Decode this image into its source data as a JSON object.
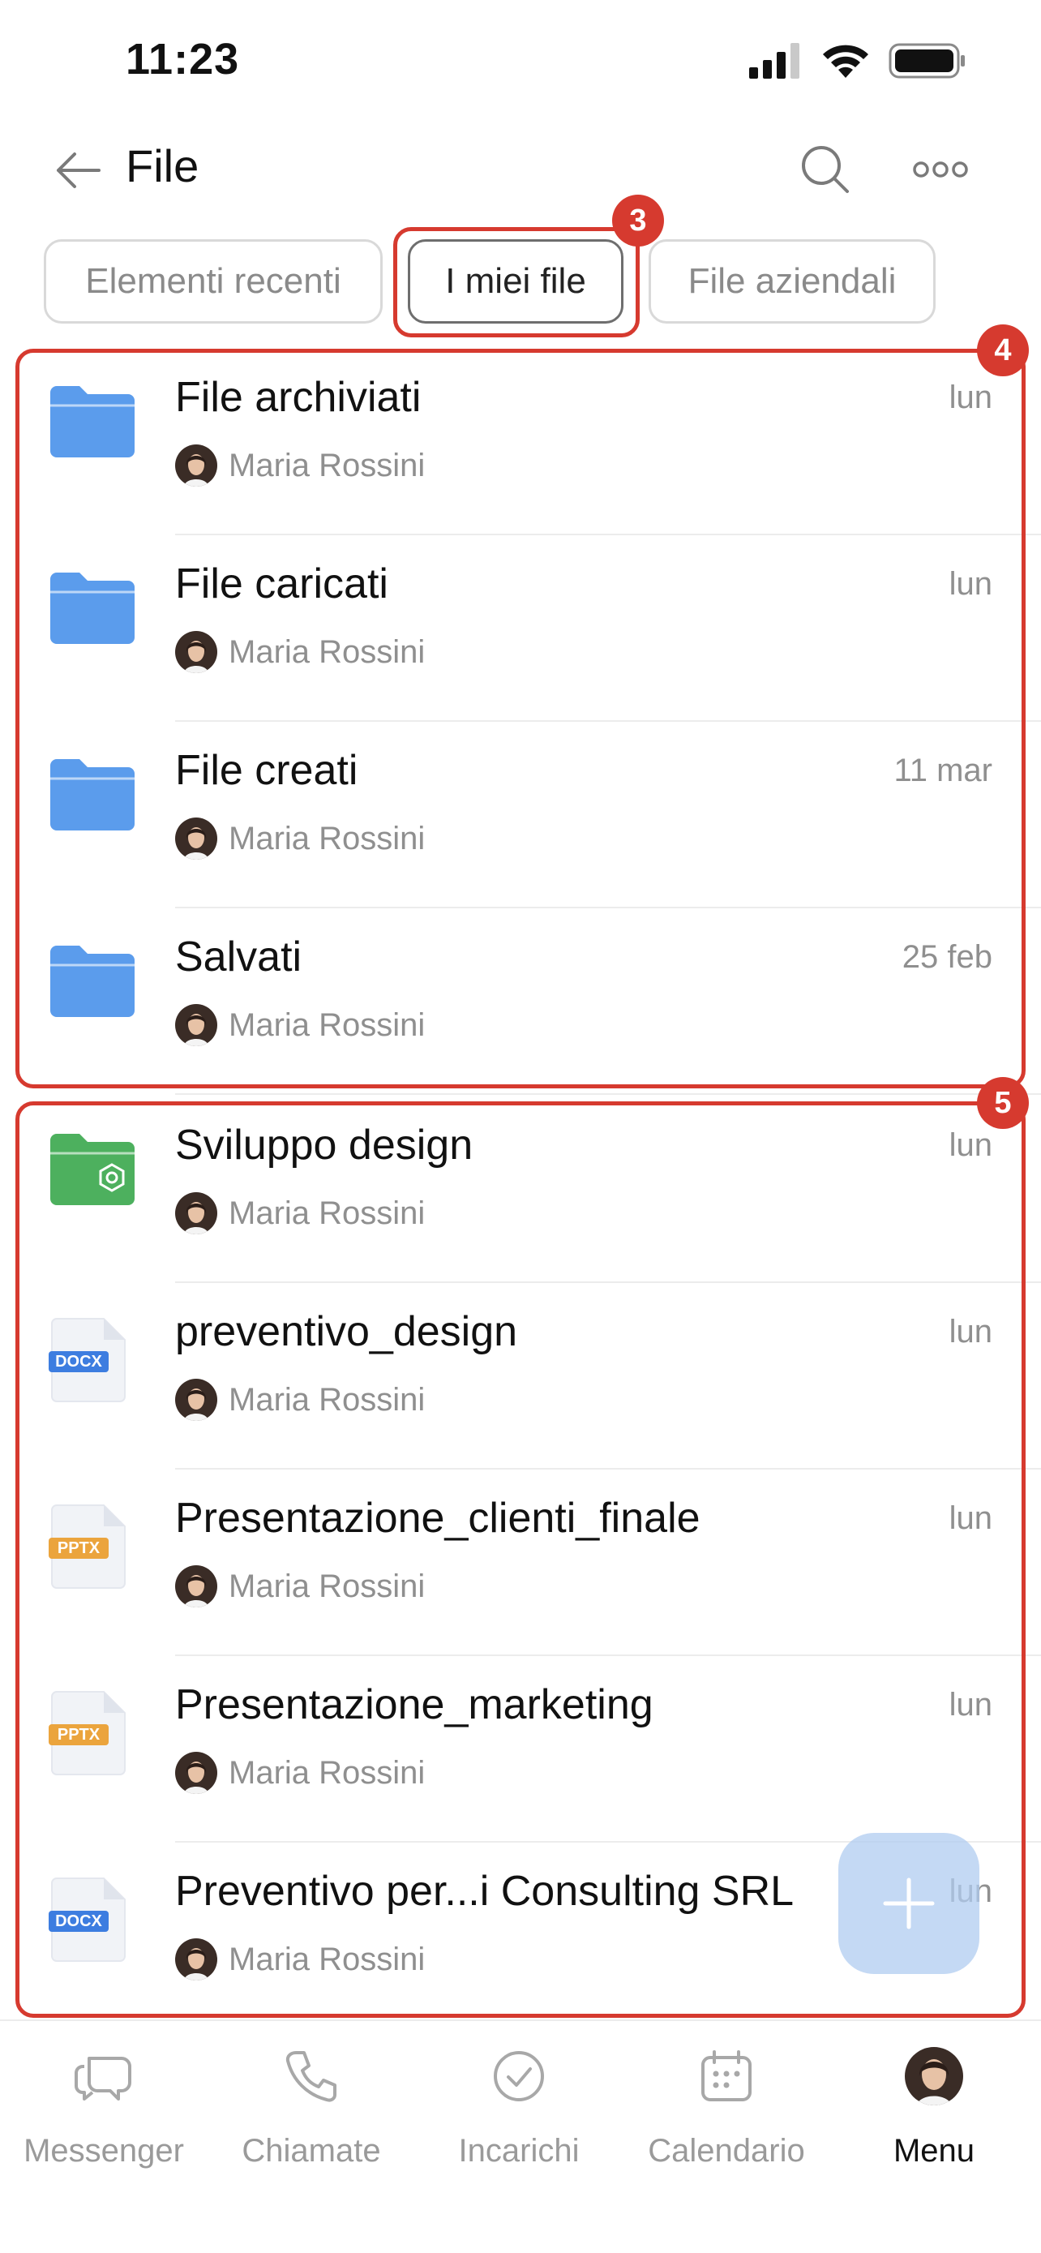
{
  "status_bar": {
    "time": "11:23"
  },
  "header": {
    "title": "File"
  },
  "tabs": [
    {
      "label": "Elementi recenti",
      "active": false
    },
    {
      "label": "I miei file",
      "active": true
    },
    {
      "label": "File aziendali",
      "active": false
    }
  ],
  "annotations": {
    "tab_badge": "3",
    "folders_badge": "4",
    "files_badge": "5",
    "color": "#d63a2f"
  },
  "folders": [
    {
      "title": "File archiviati",
      "owner": "Maria Rossini",
      "date": "lun",
      "icon": "folder-icon"
    },
    {
      "title": "File caricati",
      "owner": "Maria Rossini",
      "date": "lun",
      "icon": "folder-icon"
    },
    {
      "title": "File creati",
      "owner": "Maria Rossini",
      "date": "11 mar",
      "icon": "folder-icon"
    },
    {
      "title": "Salvati",
      "owner": "Maria Rossini",
      "date": "25 feb",
      "icon": "folder-icon"
    }
  ],
  "files": [
    {
      "title": "Sviluppo design",
      "owner": "Maria Rossini",
      "date": "lun",
      "icon": "shared-folder-icon",
      "badge": ""
    },
    {
      "title": "preventivo_design",
      "owner": "Maria Rossini",
      "date": "lun",
      "icon": "docx-file-icon",
      "badge": "DOCX"
    },
    {
      "title": "Presentazione_clienti_finale",
      "owner": "Maria Rossini",
      "date": "lun",
      "icon": "pptx-file-icon",
      "badge": "PPTX"
    },
    {
      "title": "Presentazione_marketing",
      "owner": "Maria Rossini",
      "date": "lun",
      "icon": "pptx-file-icon",
      "badge": "PPTX"
    },
    {
      "title": "Preventivo per...i Consulting SRL",
      "owner": "Maria Rossini",
      "date": "lun",
      "icon": "docx-file-icon",
      "badge": "DOCX"
    }
  ],
  "bottom_nav": [
    {
      "label": "Messenger",
      "icon": "chat-icon",
      "active": false
    },
    {
      "label": "Chiamate",
      "icon": "phone-icon",
      "active": false
    },
    {
      "label": "Incarichi",
      "icon": "check-circle-icon",
      "active": false
    },
    {
      "label": "Calendario",
      "icon": "calendar-icon",
      "active": false
    },
    {
      "label": "Menu",
      "icon": "avatar-icon",
      "active": true
    }
  ],
  "colors": {
    "folder_blue": "#5b9cec",
    "shared_green": "#4db05e",
    "docx_blue": "#3d7de0",
    "pptx_orange": "#eba43d"
  }
}
